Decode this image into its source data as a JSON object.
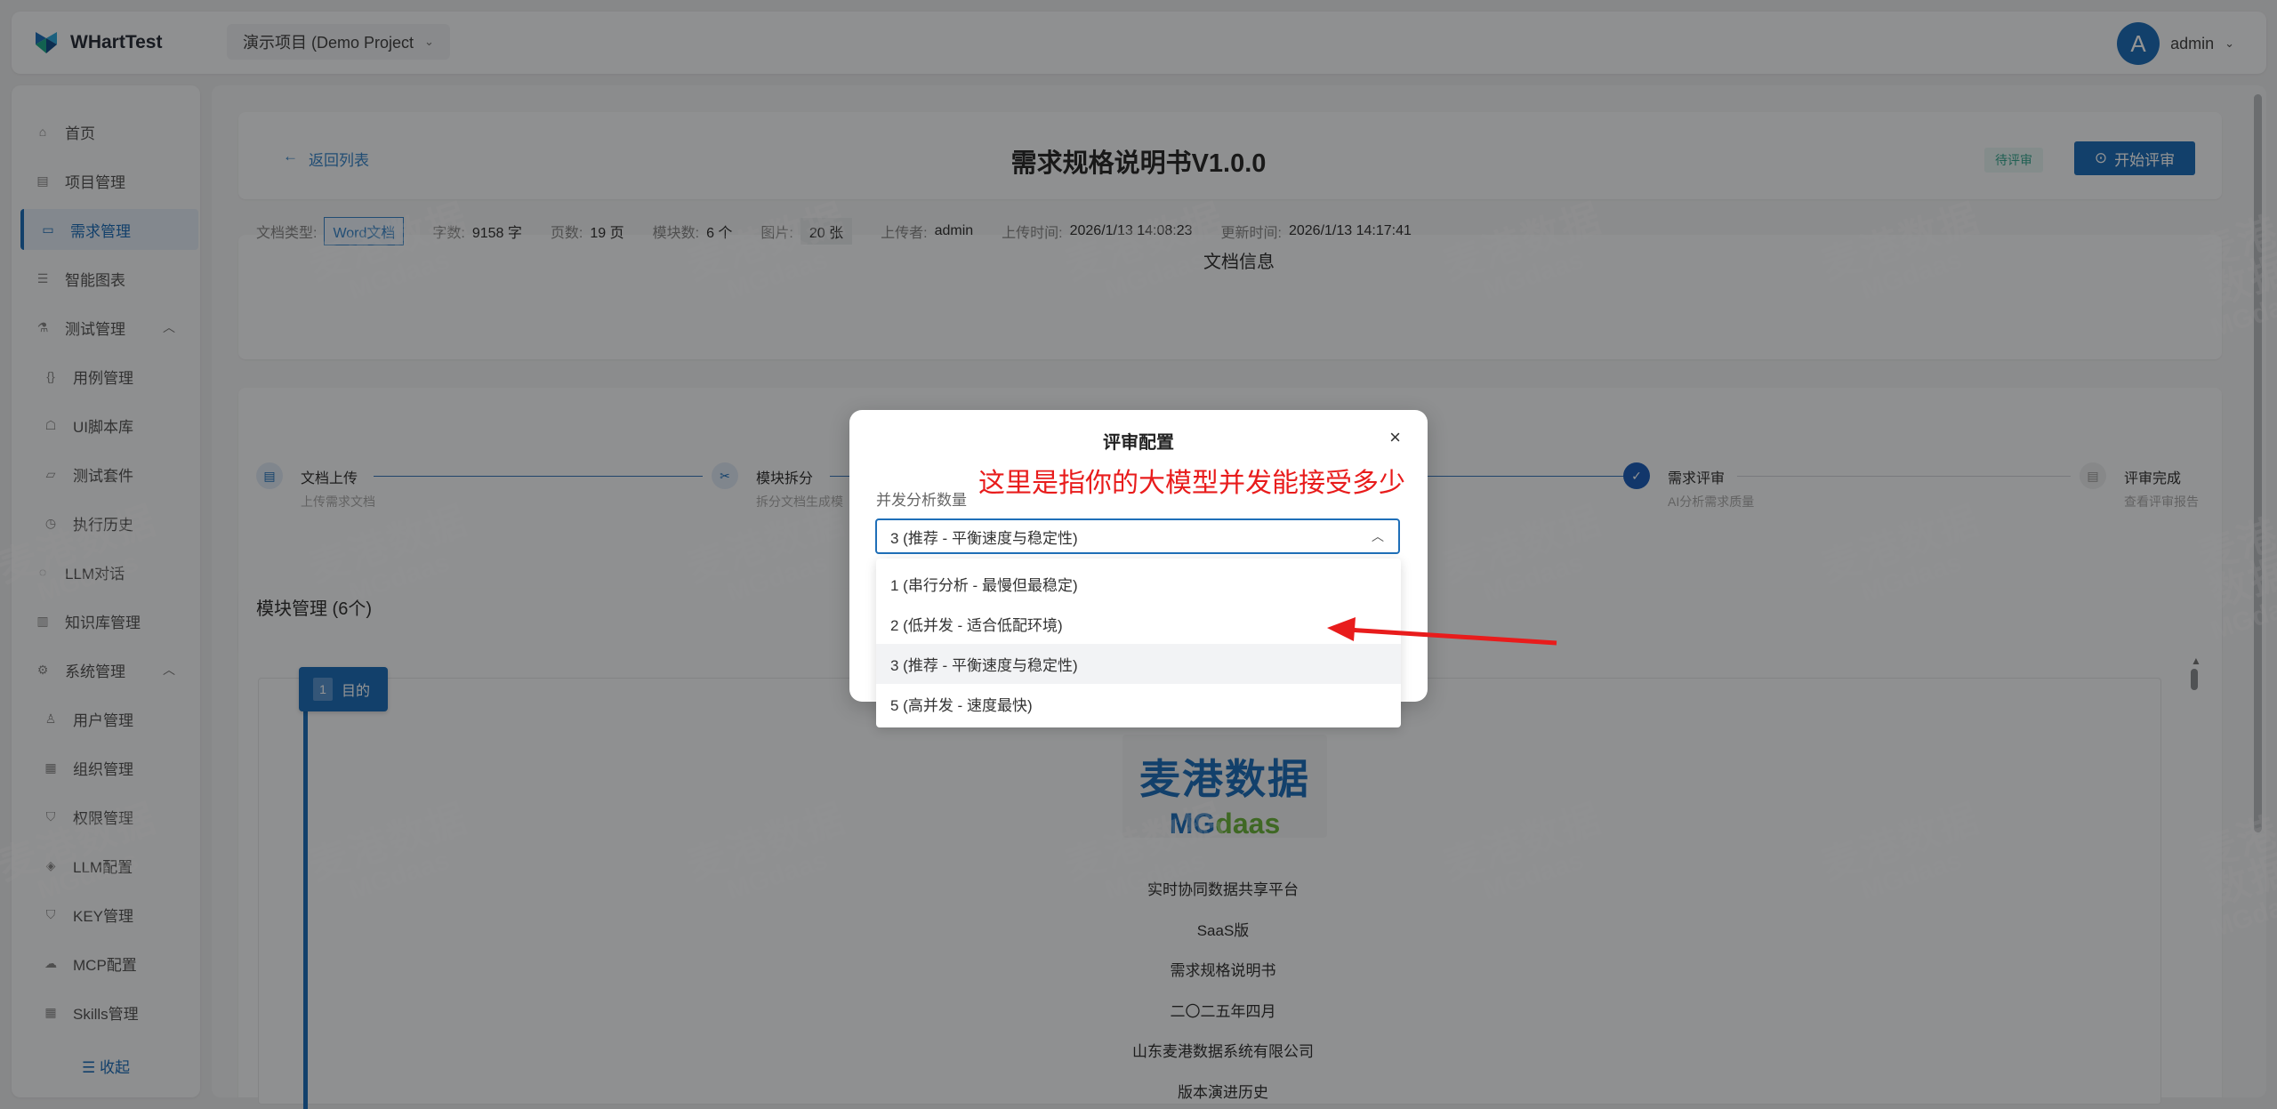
{
  "app": {
    "name": "WHartTest"
  },
  "header": {
    "project": "演示项目 (Demo Project",
    "user_initial": "A",
    "user_name": "admin"
  },
  "sidebar": {
    "items": [
      {
        "label": "首页",
        "icon": "home-icon"
      },
      {
        "label": "项目管理",
        "icon": "project-icon"
      },
      {
        "label": "需求管理",
        "icon": "requirement-icon"
      },
      {
        "label": "智能图表",
        "icon": "chart-icon"
      },
      {
        "label": "测试管理",
        "icon": "test-icon"
      },
      {
        "label": "用例管理",
        "icon": "code-icon"
      },
      {
        "label": "UI脚本库",
        "icon": "robot-icon"
      },
      {
        "label": "测试套件",
        "icon": "folder-icon"
      },
      {
        "label": "执行历史",
        "icon": "clock-icon"
      },
      {
        "label": "LLM对话",
        "icon": "chat-icon"
      },
      {
        "label": "知识库管理",
        "icon": "book-icon"
      },
      {
        "label": "系统管理",
        "icon": "settings-icon"
      },
      {
        "label": "用户管理",
        "icon": "user-icon"
      },
      {
        "label": "组织管理",
        "icon": "org-icon"
      },
      {
        "label": "权限管理",
        "icon": "shield-icon"
      },
      {
        "label": "LLM配置",
        "icon": "llm-icon"
      },
      {
        "label": "KEY管理",
        "icon": "key-icon"
      },
      {
        "label": "MCP配置",
        "icon": "cloud-icon"
      },
      {
        "label": "Skills管理",
        "icon": "grid-icon"
      }
    ],
    "collapse_label": "收起"
  },
  "doc": {
    "back_label": "返回列表",
    "title": "需求规格说明书V1.0.0",
    "status": "待评审",
    "start_label": "开始评审"
  },
  "info": {
    "title": "文档信息",
    "type_label": "文档类型:",
    "type_value": "Word文档",
    "words_label": "字数:",
    "words_value": "9158 字",
    "pages_label": "页数:",
    "pages_value": "19 页",
    "modules_label": "模块数:",
    "modules_value": "6 个",
    "images_label": "图片:",
    "images_value": "20 张",
    "uploader_label": "上传者:",
    "uploader_value": "admin",
    "upload_time_label": "上传时间:",
    "upload_time_value": "2026/1/13 14:08:23",
    "update_time_label": "更新时间:",
    "update_time_value": "2026/1/13 14:17:41"
  },
  "steps": [
    {
      "title": "文档上传",
      "desc": "上传需求文档"
    },
    {
      "title": "模块拆分",
      "desc": "拆分文档生成模"
    },
    {
      "title": "需求评审",
      "desc": "AI分析需求质量"
    },
    {
      "title": "评审完成",
      "desc": "查看评审报告"
    }
  ],
  "modules": {
    "title": "模块管理 (6个)",
    "first_num": "1",
    "first_name": "目的",
    "logo_cn": "麦港数据",
    "logo_en_a": "MG",
    "logo_en_b": "daas",
    "lines": [
      "实时协同数据共享平台",
      "SaaS版",
      "需求规格说明书",
      "二〇二五年四月",
      "山东麦港数据系统有限公司",
      "版本演进历史"
    ]
  },
  "modal": {
    "title": "评审配置",
    "close": "×",
    "field_label": "并发分析数量",
    "selected": "3 (推荐 - 平衡速度与稳定性)",
    "options": [
      "1 (串行分析 - 最慢但最稳定)",
      "2 (低并发 - 适合低配环境)",
      "3 (推荐 - 平衡速度与稳定性)",
      "5 (高并发 - 速度最快)"
    ],
    "selected_index": 2
  },
  "annotation": {
    "text": "这里是指你的大模型并发能接受多少",
    "color": "#e81c1c"
  },
  "watermark": {
    "cn": "麦港数据",
    "en": "MGdaas"
  },
  "colors": {
    "primary": "#1f6fb8",
    "status": "#37a690",
    "annotation": "#e81c1c"
  }
}
